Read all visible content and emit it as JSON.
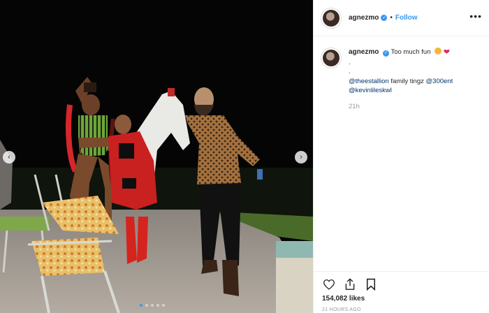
{
  "post": {
    "username": "agnezmo",
    "follow_label": "Follow",
    "separator": "•",
    "more_glyph": "•••",
    "caption": {
      "username": "agnezmo",
      "line1": "Too much fun",
      "dot1": ".",
      "dot2": ".",
      "mention1": "@theestallion",
      "text2": " family tingz ",
      "mention2": "@300ent",
      "mention3": "@kevinlileskwl",
      "age": "21h"
    },
    "likes": "154,082 likes",
    "posted": "21 HOURS AGO"
  },
  "carousel": {
    "total_slides": 5,
    "current_slide": 1,
    "prev_glyph": "‹",
    "next_glyph": "›"
  },
  "icons": [
    "heart-outline-icon",
    "share-icon",
    "bookmark-icon",
    "verified-icon",
    "ellipsis-icon"
  ],
  "colors": {
    "accent": "#3897f0",
    "text": "#262626",
    "muted": "#999999",
    "mention": "#00376b",
    "border": "#efefef"
  }
}
